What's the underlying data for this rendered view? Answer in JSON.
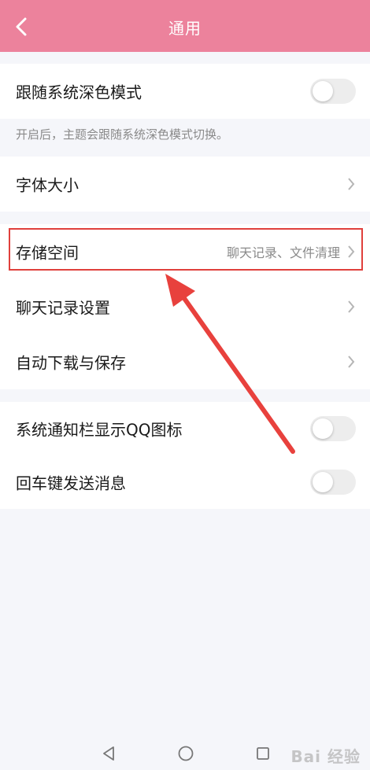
{
  "header": {
    "title": "通用"
  },
  "settings": {
    "dark_mode": {
      "label": "跟随系统深色模式",
      "enabled": false
    },
    "dark_mode_hint": "开启后，主题会跟随系统深色模式切换。",
    "font_size": {
      "label": "字体大小"
    },
    "storage": {
      "label": "存储空间",
      "value": "聊天记录、文件清理"
    },
    "chat_history": {
      "label": "聊天记录设置"
    },
    "auto_download": {
      "label": "自动下载与保存"
    },
    "notification_icon": {
      "label": "系统通知栏显示QQ图标",
      "enabled": false
    },
    "enter_send": {
      "label": "回车键发送消息",
      "enabled": false
    }
  },
  "watermark": "Bai 经验",
  "colors": {
    "header": "#ec829c",
    "highlight": "#e0403c",
    "arrow": "#e8413d"
  }
}
